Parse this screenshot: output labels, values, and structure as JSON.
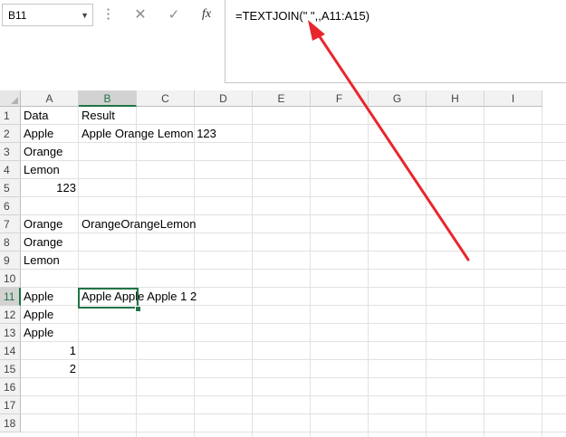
{
  "name_box": {
    "value": "B11"
  },
  "formula_bar": {
    "cancel_glyph": "✕",
    "enter_glyph": "✓",
    "fx_label": "fx",
    "formula": "=TEXTJOIN(\" \",,A11:A15)"
  },
  "columns": [
    "A",
    "B",
    "C",
    "D",
    "E",
    "F",
    "G",
    "H",
    "I"
  ],
  "rows": [
    "1",
    "2",
    "3",
    "4",
    "5",
    "6",
    "7",
    "8",
    "9",
    "10",
    "11",
    "12",
    "13",
    "14",
    "15",
    "16",
    "17",
    "18"
  ],
  "selected_cell": "B11",
  "cells": {
    "A1": "Data",
    "B1": "Result",
    "A2": "Apple",
    "B2": "Apple Orange Lemon 123",
    "A3": "Orange",
    "A4": "Lemon",
    "A5": "123",
    "A7": "Orange",
    "B7": "OrangeOrangeLemon",
    "A8": "Orange",
    "A9": "Lemon",
    "A11": "Apple",
    "B11": "Apple Apple Apple 1 2",
    "A12": "Apple",
    "A13": "Apple",
    "A14": "1",
    "A15": "2"
  },
  "colors": {
    "accent": "#217346",
    "arrow": "#e8262c"
  },
  "annotation": {
    "type": "arrow",
    "points_to": "formula-text"
  }
}
